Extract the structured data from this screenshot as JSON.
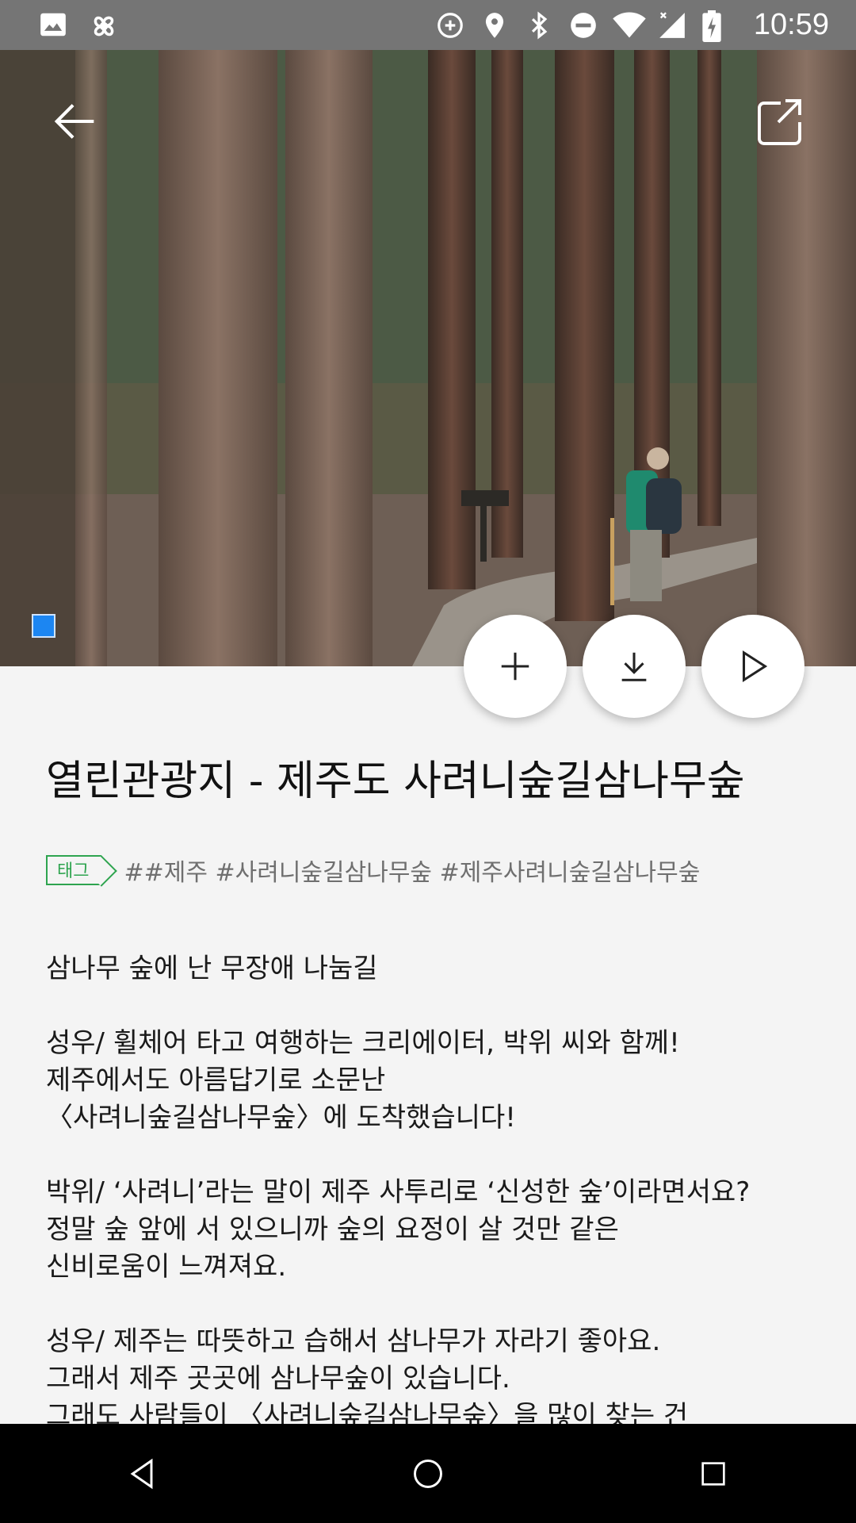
{
  "status_bar": {
    "time": "10:59",
    "icons": [
      "image-icon",
      "pinwheel-icon",
      "data-saver-icon",
      "location-icon",
      "bluetooth-icon",
      "do-not-disturb-icon",
      "wifi-icon",
      "signal-icon",
      "battery-charging-icon"
    ]
  },
  "hero": {
    "back_icon": "arrow-left-icon",
    "share_icon": "share-icon"
  },
  "actions": {
    "add_icon": "plus-icon",
    "download_icon": "download-icon",
    "play_icon": "play-icon"
  },
  "content": {
    "title": "열린관광지 - 제주도 사려니숲길삼나무숲",
    "tag_label": "태그",
    "tags": "##제주 #사려니숲길삼나무숲 #제주사려니숲길삼나무숲",
    "paragraphs": [
      "삼나무 숲에 난 무장애 나눔길",
      "성우/ 휠체어 타고 여행하는 크리에이터, 박위 씨와 함께!\n제주에서도 아름답기로 소문난\n〈사려니숲길삼나무숲〉에 도착했습니다!",
      "박위/ ‘사려니’라는 말이 제주 사투리로 ‘신성한 숲’이라면서요?\n정말 숲 앞에 서 있으니까 숲의 요정이 살 것만 같은\n신비로움이 느껴져요.",
      "성우/ 제주는 따뜻하고 습해서 삼나무가 자라기 좋아요.\n그래서 제주 곳곳에 삼나무숲이 있습니다.\n그래도 사람들이 〈사려니숲길삼나무숲〉을 많이 찾는 건"
    ]
  },
  "nav_bar": {
    "back": "nav-back-icon",
    "home": "nav-home-icon",
    "recents": "nav-recents-icon"
  },
  "colors": {
    "status_bar": "#757575",
    "tag_green": "#2ea44f",
    "indicator_blue": "#1c86f2",
    "background": "#f4f4f4"
  }
}
